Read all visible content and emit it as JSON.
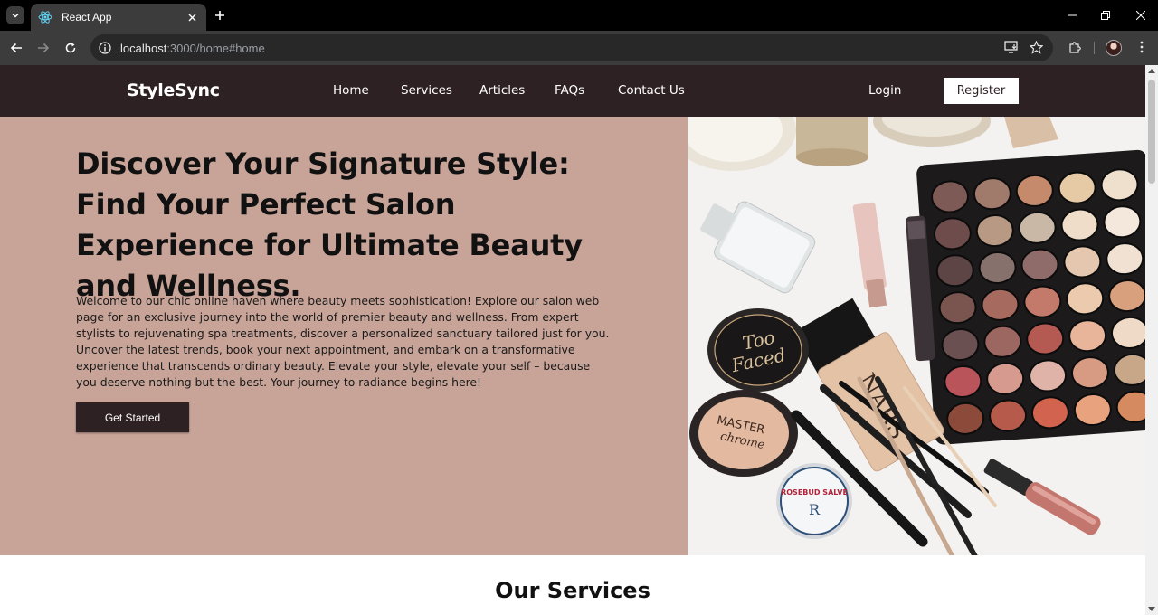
{
  "browser": {
    "tab_title": "React App",
    "url_host": "localhost",
    "url_path": ":3000/home#home"
  },
  "site": {
    "brand": "StyleSync",
    "nav": [
      "Home",
      "Services",
      "Articles",
      "FAQs",
      "Contact Us"
    ],
    "login_label": "Login",
    "register_label": "Register"
  },
  "hero": {
    "title": "Discover Your Signature Style: Find Your Perfect Salon Experience for Ultimate Beauty and Wellness.",
    "body": "Welcome to our chic online haven where beauty meets sophistication! Explore our salon web page for an exclusive journey into the world of premier beauty and wellness. From expert stylists to rejuvenating spa treatments, discover a personalized sanctuary tailored just for you. Uncover the latest trends, book your next appointment, and embark on a transformative experience that transcends ordinary beauty. Elevate your style, elevate your self – because you deserve nothing but the best. Your journey to radiance begins here!",
    "cta_label": "Get Started",
    "image_labels": {
      "compact": [
        "Too",
        "Faced"
      ],
      "foundation": "NARS",
      "highlighter": [
        "MASTER",
        "chrome"
      ],
      "salve": "ROSEBUD SALVE"
    }
  },
  "services": {
    "heading": "Our Services"
  },
  "colors": {
    "nav_bg": "#2e2124",
    "hero_bg": "#c8a498",
    "button_bg": "#2e2124"
  }
}
